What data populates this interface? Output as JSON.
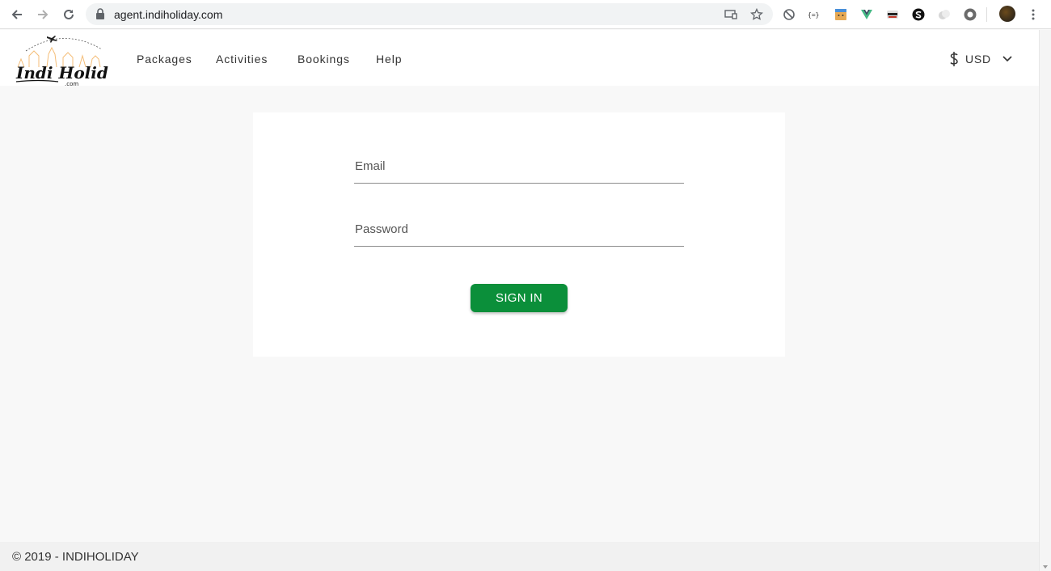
{
  "browser": {
    "url": "agent.indiholiday.com"
  },
  "site": {
    "logo_text": "Indi Holiday",
    "logo_sub": ".com",
    "nav": [
      {
        "label": "Packages"
      },
      {
        "label": "Activities"
      },
      {
        "label": "Bookings"
      },
      {
        "label": "Help"
      }
    ],
    "currency": {
      "symbol": "$",
      "code": "USD"
    }
  },
  "login": {
    "email_label": "Email",
    "password_label": "Password",
    "signin_label": "SIGN IN"
  },
  "footer": {
    "copyright": "© 2019 - INDIHOLIDAY"
  },
  "colors": {
    "accent": "#0b8f3a",
    "background": "#f8f8f8"
  }
}
